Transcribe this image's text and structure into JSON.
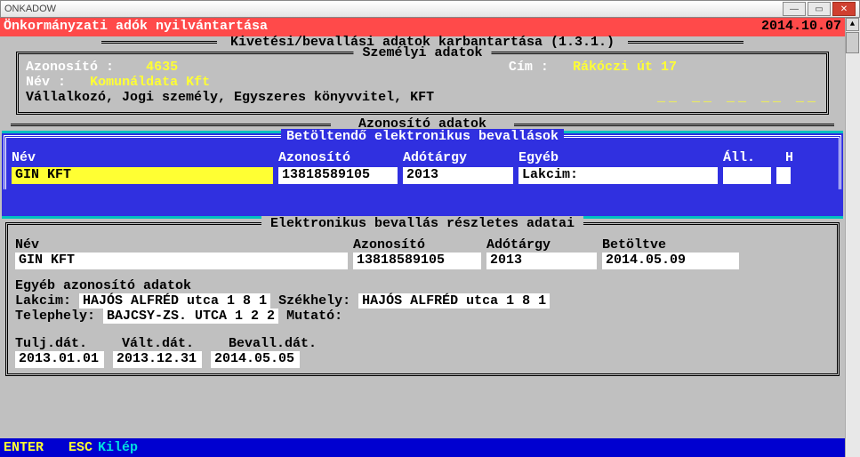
{
  "window": {
    "title": "ONKADOW"
  },
  "header": {
    "title": "Önkormányzati adók nyilvántartása",
    "date": "2014.10.07"
  },
  "section131": "Kivetési/bevallási adatok karbantartása (1.3.1.)",
  "szemelyi": {
    "title": "Személyi adatok",
    "azon_label": "Azonosító :",
    "azon_value": "4635",
    "cim_label": "Cím :",
    "cim_value": "Rákóczi út 17",
    "nev_label": "Név :",
    "nev_value": "Komunáldata Kft",
    "info": "Vállalkozó, Jogi személy, Egyszeres könyvvitel, KFT",
    "dashes": "__ __ __ __ __"
  },
  "azon_adatok_title": "Azonosító adatok",
  "blue": {
    "title": "Betöltendő elektronikus bevallások",
    "headers": {
      "nev": "Név",
      "azon": "Azonosító",
      "tar": "Adótárgy",
      "egy": "Egyéb",
      "all": "Áll.",
      "h": "H"
    },
    "row": {
      "nev": "GIN KFT",
      "azon": "13818589105",
      "tar": "2013",
      "egy": "Lakcim:",
      "all": "",
      "h": ""
    }
  },
  "details": {
    "title": "Elektronikus bevallás részletes adatai",
    "headers": {
      "nev": "Név",
      "azon": "Azonosító",
      "tar": "Adótárgy",
      "bet": "Betöltve"
    },
    "row": {
      "nev": "GIN KFT",
      "azon": "13818589105",
      "tar": "2013",
      "bet": "2014.05.09"
    },
    "egyeb_title": "Egyéb azonosító adatok",
    "lakcim_label": "Lakcim:",
    "lakcim_value": "HAJÓS ALFRÉD utca 1 8 1",
    "szekhely_label": "Székhely:",
    "szekhely_value": "HAJÓS ALFRÉD utca 1 8 1 ",
    "telephely_label": "Telephely:",
    "telephely_value": "BAJCSY-ZS. UTCA 1 2 2",
    "mutato_label": "Mutató:",
    "dates_headers": {
      "tulj": "Tulj.dát.",
      "valt": "Vált.dát.",
      "bev": "Bevall.dát."
    },
    "dates": {
      "tulj": "2013.01.01",
      "valt": "2013.12.31",
      "bev": "2014.05.05"
    }
  },
  "bottom": {
    "enter": "ENTER",
    "esc": "ESC",
    "kilep": "Kilép"
  }
}
